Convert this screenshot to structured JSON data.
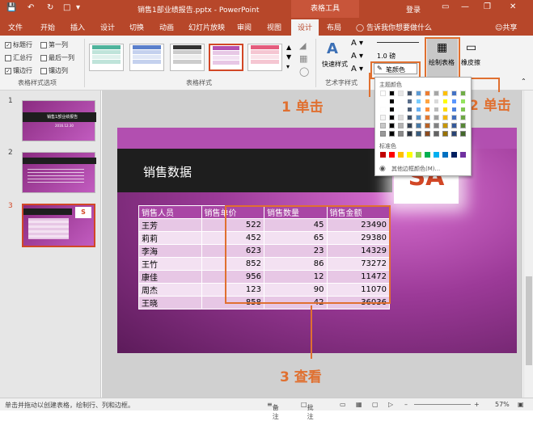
{
  "titlebar": {
    "doc_title": "销售1部业绩报告.pptx - PowerPoint",
    "context_tab": "表格工具",
    "login": "登录"
  },
  "tabs": [
    "文件",
    "开始",
    "插入",
    "设计",
    "切换",
    "动画",
    "幻灯片放映",
    "审阅",
    "视图",
    "设计",
    "布局"
  ],
  "tell_me": "告诉我你想要做什么",
  "share": "共享",
  "options": {
    "items": [
      {
        "label": "标题行",
        "checked": true
      },
      {
        "label": "第一列",
        "checked": false
      },
      {
        "label": "汇总行",
        "checked": false
      },
      {
        "label": "最后一列",
        "checked": false
      },
      {
        "label": "镶边行",
        "checked": true
      },
      {
        "label": "镶边列",
        "checked": false
      }
    ],
    "group_label": "表格样式选项"
  },
  "styles_group_label": "表格样式",
  "quick_styles": "快速样式",
  "wordart_label": "艺术字样式",
  "pen": {
    "weight": "1.0 磅",
    "color_button": "笔颜色",
    "draw_table": "绘制表格",
    "eraser": "橡皮擦"
  },
  "palette": {
    "theme_label": "主题颜色",
    "standard_label": "标准色",
    "more": "其他边框颜色(M)..."
  },
  "callouts": {
    "one": "1 单击",
    "two": "2 单击",
    "three": "3 查看"
  },
  "slides": [
    {
      "num": "1",
      "title": "销售1部业绩报告",
      "date": "2016.12.30"
    },
    {
      "num": "2"
    },
    {
      "num": "3"
    }
  ],
  "slide": {
    "title": "销售数据",
    "logo": "SA",
    "headers": [
      "销售人员",
      "销售单价",
      "销售数量",
      "销售金额"
    ],
    "rows": [
      [
        "王芳",
        "522",
        "45",
        "23490"
      ],
      [
        "莉莉",
        "452",
        "65",
        "29380"
      ],
      [
        "李海",
        "623",
        "23",
        "14329"
      ],
      [
        "王竹",
        "852",
        "86",
        "73272"
      ],
      [
        "康佳",
        "956",
        "12",
        "11472"
      ],
      [
        "周杰",
        "123",
        "90",
        "11070"
      ],
      [
        "王晓",
        "858",
        "42",
        "36036"
      ]
    ]
  },
  "status": {
    "hint": "单击并拖动以创建表格，绘制行、列和边框。",
    "notes": "备注",
    "comments": "批注",
    "zoom": "57%"
  }
}
